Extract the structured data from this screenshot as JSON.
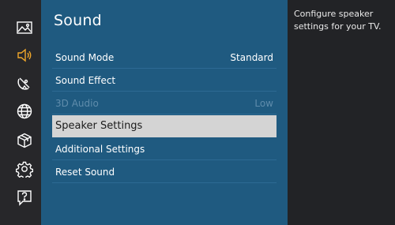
{
  "sidebar": {
    "icons": [
      {
        "name": "picture-icon"
      },
      {
        "name": "sound-icon",
        "active": true
      },
      {
        "name": "broadcasting-icon"
      },
      {
        "name": "network-icon"
      },
      {
        "name": "system-icon"
      },
      {
        "name": "settings-icon"
      },
      {
        "name": "support-icon"
      }
    ],
    "active_color": "#f0a72a",
    "icon_color": "#ffffff"
  },
  "panel": {
    "title": "Sound",
    "items": [
      {
        "label": "Sound Mode",
        "value": "Standard",
        "state": "normal"
      },
      {
        "label": "Sound Effect",
        "value": "",
        "state": "normal"
      },
      {
        "label": "3D Audio",
        "value": "Low",
        "state": "disabled"
      },
      {
        "label": "Speaker Settings",
        "value": "",
        "state": "selected"
      },
      {
        "label": "Additional Settings",
        "value": "",
        "state": "normal"
      },
      {
        "label": "Reset Sound",
        "value": "",
        "state": "normal"
      }
    ]
  },
  "help": {
    "text": "Configure speaker settings for your TV."
  },
  "colors": {
    "panel_bg": "#1f5a80",
    "selected_bg": "#d4d4d4",
    "background": "#222326"
  }
}
